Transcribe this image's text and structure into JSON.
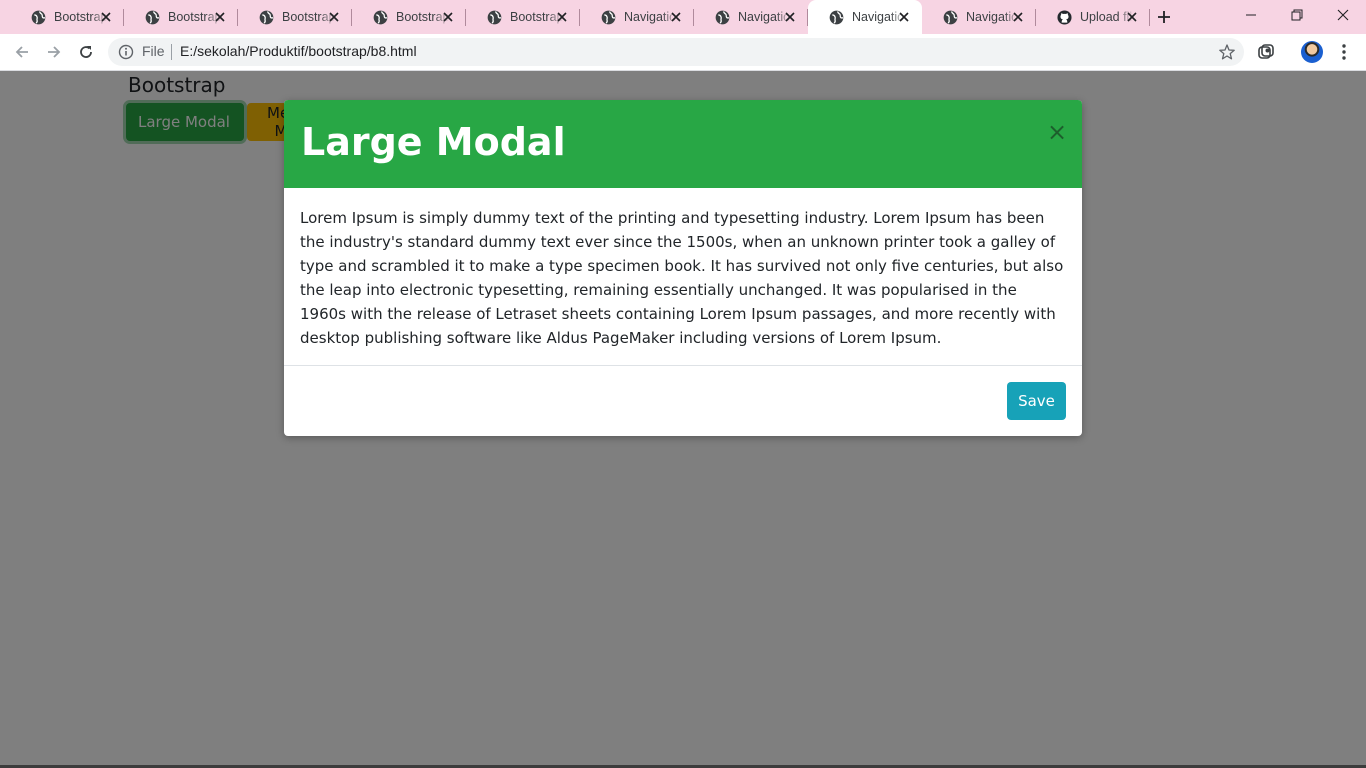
{
  "browser": {
    "tabs": [
      {
        "title": "Bootstrap",
        "icon": "globe-icon",
        "active": false
      },
      {
        "title": "Bootstrap",
        "icon": "globe-icon",
        "active": false
      },
      {
        "title": "Bootstrap",
        "icon": "globe-icon",
        "active": false
      },
      {
        "title": "Bootstrap",
        "icon": "globe-icon",
        "active": false
      },
      {
        "title": "Bootstrap",
        "icon": "globe-icon",
        "active": false
      },
      {
        "title": "Navigation",
        "icon": "globe-icon",
        "active": false
      },
      {
        "title": "Navigation",
        "icon": "globe-icon",
        "active": false
      },
      {
        "title": "Navigation",
        "icon": "globe-icon",
        "active": true
      },
      {
        "title": "Navigation",
        "icon": "globe-icon",
        "active": false
      },
      {
        "title": "Upload files",
        "icon": "github-icon",
        "active": false
      }
    ],
    "address": {
      "scheme_label": "File",
      "url": "E:/sekolah/Produktif/bootstrap/b8.html"
    },
    "colors": {
      "tabstrip": "#f7d4e3",
      "toolbar": "#ffffff"
    }
  },
  "page": {
    "heading": "Bootstrap",
    "buttons": {
      "large_modal": "Large Modal",
      "medium_modal": "Medium Modal"
    }
  },
  "modal": {
    "title": "Large Modal",
    "close_symbol": "×",
    "body": "Lorem Ipsum is simply dummy text of the printing and typesetting industry. Lorem Ipsum has been the industry's standard dummy text ever since the 1500s, when an unknown printer took a galley of type and scrambled it to make a type specimen book. It has survived not only five centuries, but also the leap into electronic typesetting, remaining essentially unchanged. It was popularised in the 1960s with the release of Letraset sheets containing Lorem Ipsum passages, and more recently with desktop publishing software like Aldus PageMaker including versions of Lorem Ipsum.",
    "save_label": "Save",
    "colors": {
      "header": "#28a745",
      "save": "#17a2b8",
      "backdrop": "rgba(0,0,0,0.5)"
    }
  }
}
